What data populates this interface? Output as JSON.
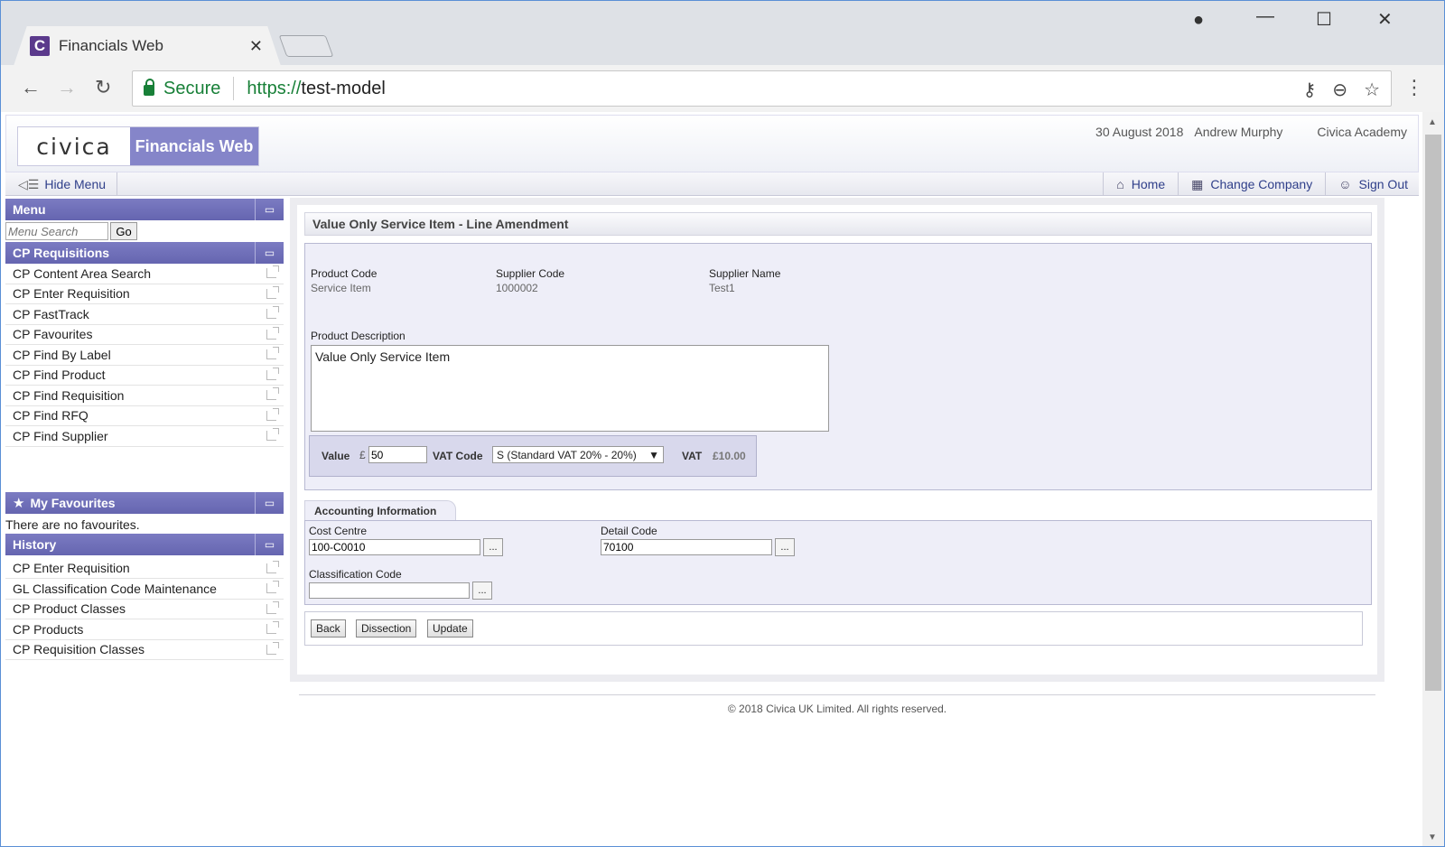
{
  "browser": {
    "tab_title": "Financials Web",
    "favicon_letter": "C",
    "secure_label": "Secure",
    "url_scheme": "https://",
    "url_host": "test-model"
  },
  "header": {
    "logo_civica": "civica",
    "logo_product": "Financials Web",
    "date": "30 August 2018",
    "user": "Andrew Murphy",
    "organisation": "Civica Academy"
  },
  "navbar": {
    "hide_menu": "Hide Menu",
    "home": "Home",
    "change_company": "Change Company",
    "sign_out": "Sign Out"
  },
  "sidebar": {
    "menu_title": "Menu",
    "search_placeholder": "Menu Search",
    "go_label": "Go",
    "requisitions_title": "CP Requisitions",
    "requisition_items": [
      "CP Content Area Search",
      "CP Enter Requisition",
      "CP FastTrack",
      "CP Favourites",
      "CP Find By Label",
      "CP Find Product",
      "CP Find Requisition",
      "CP Find RFQ",
      "CP Find Supplier"
    ],
    "favourites_title": "My Favourites",
    "no_favourites": "There are no favourites.",
    "history_title": "History",
    "history_items": [
      "CP Enter Requisition",
      "GL Classification Code Maintenance",
      "CP Product Classes",
      "CP Products",
      "CP Requisition Classes"
    ]
  },
  "main": {
    "title": "Value Only Service Item - Line Amendment",
    "product_code_label": "Product Code",
    "product_code_value": "Service Item",
    "supplier_code_label": "Supplier Code",
    "supplier_code_value": "1000002",
    "supplier_name_label": "Supplier Name",
    "supplier_name_value": "Test1",
    "product_description_label": "Product Description",
    "product_description_value": "Value Only Service Item",
    "value_label": "Value",
    "currency_symbol": "£",
    "value_value": "50",
    "vat_code_label": "VAT Code",
    "vat_code_value": "S (Standard VAT 20% - 20%)",
    "vat_label": "VAT",
    "vat_amount": "£10.00",
    "accounting_tab": "Accounting Information",
    "cost_centre_label": "Cost Centre",
    "cost_centre_value": "100-C0010",
    "detail_code_label": "Detail Code",
    "detail_code_value": "70100",
    "classification_code_label": "Classification Code",
    "classification_code_value": "",
    "lookup_label": "...",
    "buttons": {
      "back": "Back",
      "dissection": "Dissection",
      "update": "Update"
    }
  },
  "footer": {
    "copyright": "© 2018 Civica UK Limited. All rights reserved."
  },
  "colors": {
    "accent": "#6565b0",
    "logo_bg": "#8585c9",
    "secure": "#188038"
  }
}
